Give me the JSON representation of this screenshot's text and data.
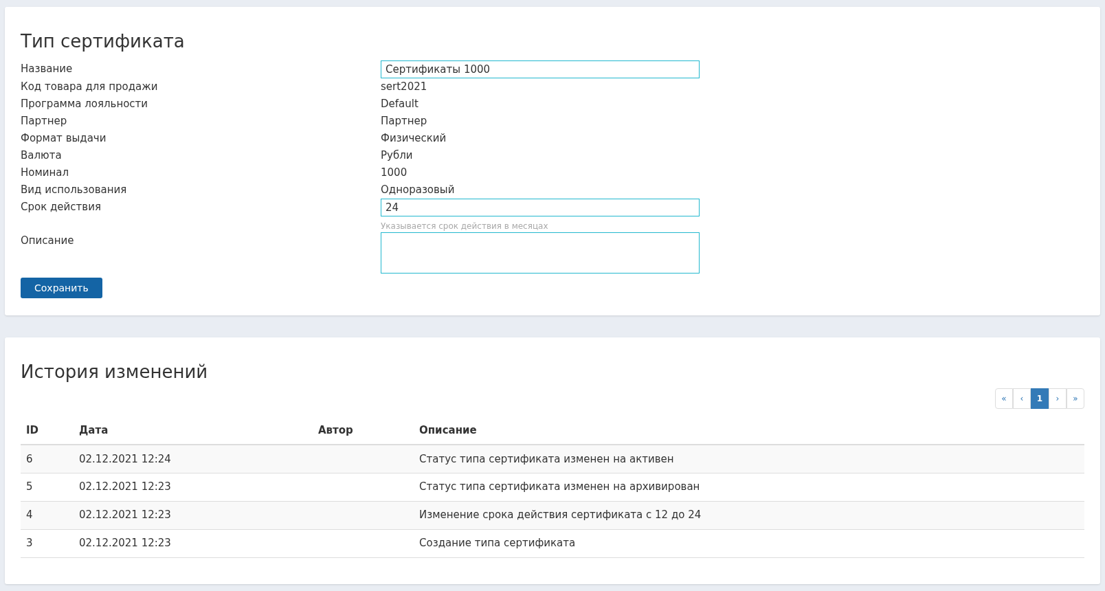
{
  "form": {
    "title": "Тип сертификата",
    "fields": [
      {
        "label": "Название",
        "kind": "input",
        "value": "Сертификаты 1000"
      },
      {
        "label": "Код товара для продажи",
        "kind": "text",
        "value": "sert2021"
      },
      {
        "label": "Программа лояльности",
        "kind": "text",
        "value": "Default"
      },
      {
        "label": "Партнер",
        "kind": "text",
        "value": "Партнер"
      },
      {
        "label": "Формат выдачи",
        "kind": "text",
        "value": "Физический"
      },
      {
        "label": "Валюта",
        "kind": "text",
        "value": "Рубли"
      },
      {
        "label": "Номинал",
        "kind": "text",
        "value": "1000"
      },
      {
        "label": "Вид использования",
        "kind": "text",
        "value": "Одноразовый"
      },
      {
        "label": "Срок действия",
        "kind": "input",
        "value": "24",
        "hint": "Указывается срок действия в месяцах"
      },
      {
        "label": "Описание",
        "kind": "textarea"
      }
    ],
    "save_button": "Сохранить"
  },
  "history": {
    "title": "История изменений",
    "pagination": [
      {
        "label": "«",
        "selected": false
      },
      {
        "label": "‹",
        "selected": false
      },
      {
        "label": "1",
        "selected": true
      },
      {
        "label": "›",
        "selected": false
      },
      {
        "label": "»",
        "selected": false
      }
    ],
    "table": {
      "columns": [
        "ID",
        "Дата",
        "Автор",
        "Описание"
      ],
      "rows": [
        [
          "6",
          "02.12.2021 12:24",
          "",
          "Статус типа сертификата изменен на активен"
        ],
        [
          "5",
          "02.12.2021 12:23",
          "",
          "Статус типа сертификата изменен на архивирован"
        ],
        [
          "4",
          "02.12.2021 12:23",
          "",
          "Изменение срока действия сертификата с 12 до 24"
        ],
        [
          "3",
          "02.12.2021 12:23",
          "",
          "Создание типа сертификата"
        ]
      ]
    }
  }
}
